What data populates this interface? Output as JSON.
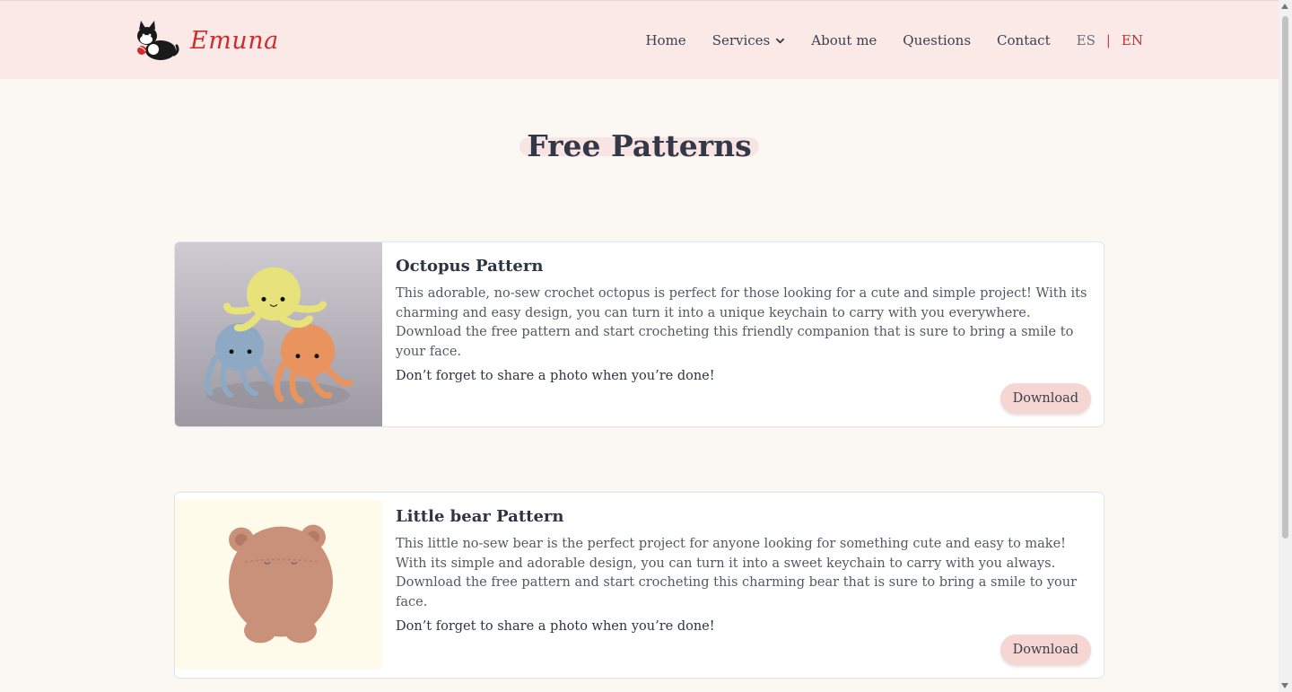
{
  "header": {
    "brand": "Emuna",
    "nav": [
      "Home",
      "Services",
      "About me",
      "Questions",
      "Contact"
    ],
    "lang": {
      "es": "ES",
      "sep": "|",
      "en": "EN"
    }
  },
  "main": {
    "title": "Free Patterns",
    "cards": [
      {
        "title": "Octopus Pattern",
        "description": "This adorable, no-sew crochet octopus is perfect for those looking for a cute and simple project! With its charming and easy design, you can turn it into a unique keychain to carry with you everywhere. Download the free pattern and start crocheting this friendly companion that is sure to bring a smile to your face.",
        "note": "Don’t forget to share a photo when you’re done!",
        "button": "Download"
      },
      {
        "title": "Little bear Pattern",
        "description": "This little no-sew bear is the perfect project for anyone looking for something cute and easy to make! With its simple and adorable design, you can turn it into a sweet keychain to carry with you always. Download the free pattern and start crocheting this charming bear that is sure to bring a smile to your face.",
        "note": "Don’t forget to share a photo when you’re done!",
        "button": "Download"
      }
    ]
  },
  "colors": {
    "brand": "#d12b2b",
    "header_bg": "#fbe9e8",
    "page_bg": "#fbf8f4",
    "button_bg": "#f6d6d3"
  },
  "icons": [
    "cat-logo-icon",
    "chevron-down-icon",
    "octopus-photo",
    "bear-photo"
  ]
}
